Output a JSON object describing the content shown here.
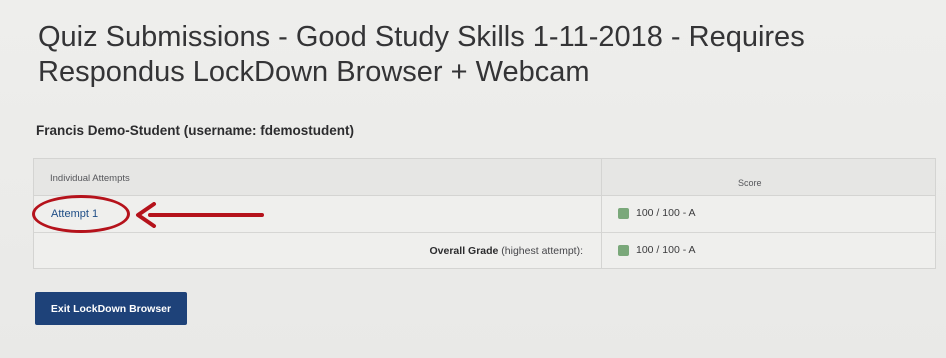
{
  "page": {
    "title": "Quiz Submissions - Good Study Skills 1-11-2018 - Requires Respondus LockDown Browser + Webcam",
    "student": "Francis Demo-Student (username: fdemostudent)"
  },
  "table": {
    "headers": {
      "attempts": "Individual Attempts",
      "score": "Score"
    },
    "attempts": [
      {
        "label": "Attempt 1",
        "score": "100 / 100 - A"
      }
    ],
    "overall": {
      "label_bold": "Overall Grade",
      "label_light": "(highest attempt):",
      "score": "100 / 100 - A"
    }
  },
  "actions": {
    "exit_label": "Exit LockDown Browser"
  },
  "colors": {
    "link": "#1e4d86",
    "button": "#1e4279",
    "grade_indicator": "#7aa87a",
    "annotation": "#b5121b"
  },
  "icons": {
    "grade_indicator": "grade-status-icon",
    "annotation_arrow": "arrow-left-icon"
  }
}
